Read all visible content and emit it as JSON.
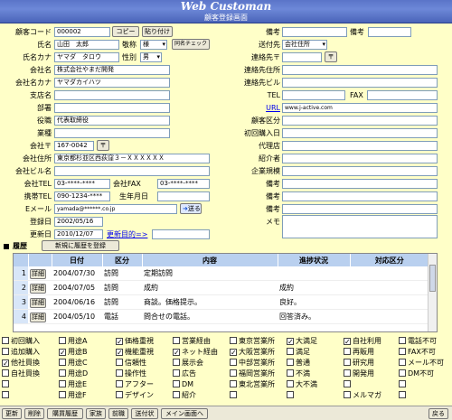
{
  "header": {
    "title": "Web Customan",
    "subtitle": "顧客登録画面"
  },
  "left": {
    "customer_code_label": "顧客コード",
    "customer_code": "000002",
    "copy_label": "コピー",
    "paste_label": "貼り付け",
    "name_label": "氏名",
    "name": "山田　太郎",
    "honorific_label": "敬称",
    "honorific": "様",
    "dup_check_label": "同名チェック",
    "kana_label": "氏名カナ",
    "kana": "ヤマダ　タロウ",
    "gender_label": "性別",
    "gender": "男",
    "company_label": "会社名",
    "company": "株式会社やまだ開発",
    "company_kana_label": "会社名カナ",
    "company_kana": "ヤマダカイハツ",
    "branch_label": "支店名",
    "branch": "",
    "dept_label": "部署",
    "dept": "",
    "position_label": "役職",
    "position": "代表取締役",
    "industry_label": "業種",
    "industry": "",
    "zip_label": "会社〒",
    "zip": "167-0042",
    "zip_btn": "〒",
    "address_label": "会社住所",
    "address": "東京都杉並区西荻窪３－ＸＸＸＸＸＸ",
    "building_label": "会社ビル名",
    "building": "",
    "tel_label": "会社TEL",
    "tel": "03-****-****",
    "fax_label": "会社FAX",
    "fax": "03-****-****",
    "mobile_label": "携帯TEL",
    "mobile": "090-1234-****",
    "birthday_label": "生年月日",
    "birthday": "",
    "email_label": "Eメール",
    "email": "yamada@******.co.jp",
    "send_label": "送る",
    "reg_date_label": "登録日",
    "reg_date": "2002/05/16",
    "upd_date_label": "更新日",
    "upd_date": "2010/12/07",
    "upd_purpose_link": "更新目的=>",
    "upd_purpose": ""
  },
  "right": {
    "note1_label": "備考",
    "note1": "",
    "note2_label": "備考",
    "note2": "",
    "send_to_label": "送付先",
    "send_to": "会社住所",
    "contact_zip_label": "連絡先〒",
    "contact_zip_btn": "〒",
    "contact_addr_label": "連絡先住所",
    "contact_building_label": "連絡先ビル",
    "tel_label": "TEL",
    "fax_label": "FAX",
    "url_label": "URL",
    "url": "www.j-active.com",
    "category_label": "顧客区分",
    "first_date_label": "初回購入日",
    "agency_label": "代理店",
    "referrer_label": "紹介者",
    "scale_label": "企業規模",
    "note3_label": "備考",
    "note4_label": "備考",
    "note5_label": "備考",
    "memo_label": "メモ"
  },
  "history": {
    "label": "履歴",
    "new_button": "新規に履歴を登録",
    "columns": [
      "日付",
      "区分",
      "内容",
      "進捗状況",
      "対応区分"
    ],
    "detail_label": "詳細",
    "rows": [
      {
        "no": "1",
        "date": "2004/07/30",
        "type": "訪問",
        "content": "定期訪問",
        "progress": ""
      },
      {
        "no": "2",
        "date": "2004/07/05",
        "type": "訪問",
        "content": "成約",
        "progress": "成約"
      },
      {
        "no": "3",
        "date": "2004/06/16",
        "type": "訪問",
        "content": "商談。価格提示。",
        "progress": "良好。"
      },
      {
        "no": "4",
        "date": "2004/05/10",
        "type": "電話",
        "content": "問合せの電話。",
        "progress": "回答済み。"
      }
    ]
  },
  "checkboxes": [
    [
      {
        "l": "初回購入",
        "c": false
      },
      {
        "l": "追加購入",
        "c": false
      },
      {
        "l": "他社買換",
        "c": true
      },
      {
        "l": "自社買換",
        "c": false
      },
      {
        "l": "",
        "c": false
      },
      {
        "l": "",
        "c": false
      }
    ],
    [
      {
        "l": "用途A",
        "c": false
      },
      {
        "l": "用途B",
        "c": true
      },
      {
        "l": "用途C",
        "c": false
      },
      {
        "l": "用途D",
        "c": false
      },
      {
        "l": "用途E",
        "c": false
      },
      {
        "l": "用途F",
        "c": false
      }
    ],
    [
      {
        "l": "価格重視",
        "c": true
      },
      {
        "l": "機能重視",
        "c": true
      },
      {
        "l": "信頼性",
        "c": false
      },
      {
        "l": "操作性",
        "c": false
      },
      {
        "l": "アフター",
        "c": false
      },
      {
        "l": "デザイン",
        "c": false
      }
    ],
    [
      {
        "l": "営業経由",
        "c": false
      },
      {
        "l": "ネット経由",
        "c": true
      },
      {
        "l": "展示会",
        "c": false
      },
      {
        "l": "広告",
        "c": false
      },
      {
        "l": "DM",
        "c": false
      },
      {
        "l": "紹介",
        "c": false
      }
    ],
    [
      {
        "l": "東京営業所",
        "c": false
      },
      {
        "l": "大阪営業所",
        "c": true
      },
      {
        "l": "中部営業所",
        "c": false
      },
      {
        "l": "福岡営業所",
        "c": false
      },
      {
        "l": "東北営業所",
        "c": false
      },
      {
        "l": "",
        "c": false
      }
    ],
    [
      {
        "l": "大満足",
        "c": true
      },
      {
        "l": "満足",
        "c": false
      },
      {
        "l": "普通",
        "c": false
      },
      {
        "l": "不満",
        "c": false
      },
      {
        "l": "大不満",
        "c": false
      },
      {
        "l": "",
        "c": false
      }
    ],
    [
      {
        "l": "自社利用",
        "c": true
      },
      {
        "l": "再販用",
        "c": false
      },
      {
        "l": "研究用",
        "c": false
      },
      {
        "l": "開発用",
        "c": false
      },
      {
        "l": "",
        "c": false
      },
      {
        "l": "メルマガ",
        "c": false
      }
    ],
    [
      {
        "l": "電話不可",
        "c": false
      },
      {
        "l": "FAX不可",
        "c": false
      },
      {
        "l": "メール不可",
        "c": false
      },
      {
        "l": "DM不可",
        "c": false
      },
      {
        "l": "",
        "c": false
      },
      {
        "l": "",
        "c": false
      }
    ]
  ],
  "footer": {
    "buttons": [
      "更新",
      "削除",
      "購買履歴",
      "家族",
      "前職",
      "送付状",
      "メイン画面へ"
    ],
    "back": "戻る"
  }
}
